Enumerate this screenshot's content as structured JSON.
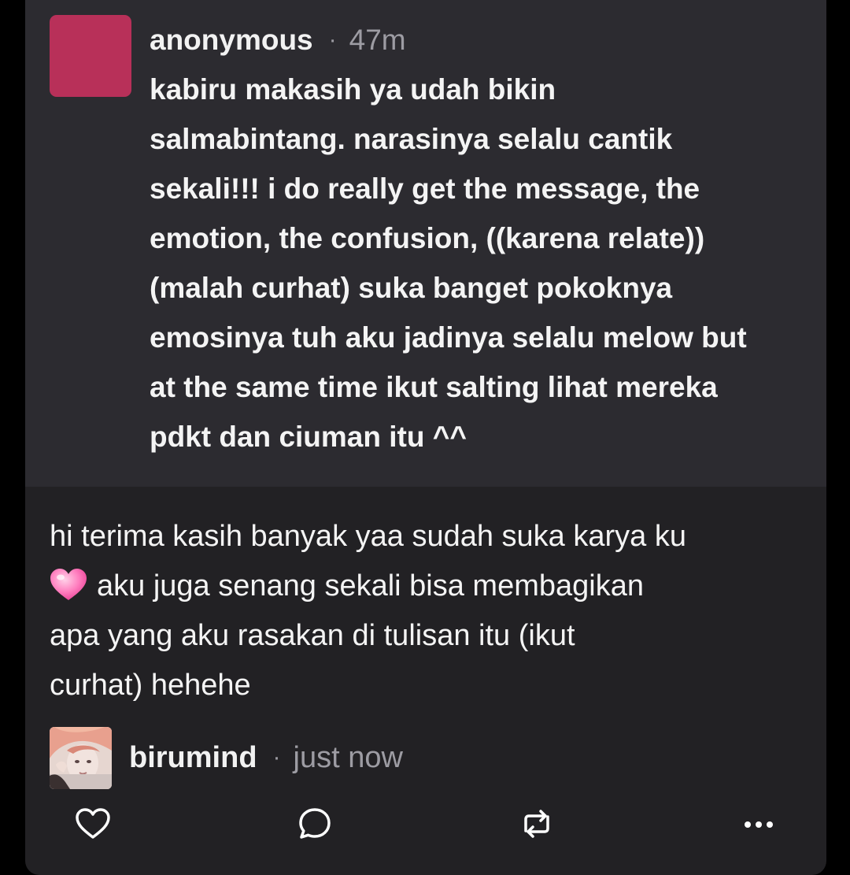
{
  "question": {
    "author": "anonymous",
    "separator": "·",
    "time": "47m",
    "lines": [
      "kabiru makasih ya udah bikin",
      "salmabintang. narasinya selalu cantik",
      "sekali!!! i do really get the message, the",
      "emotion, the confusion, ((karena relate))",
      "(malah curhat) suka banget pokoknya",
      "emosinya tuh aku jadinya selalu melow but",
      "at the same time ikut salting lihat mereka",
      "pdkt dan ciuman itu ^^"
    ]
  },
  "answer": {
    "line1": "hi terima kasih banyak yaa sudah suka karya ku",
    "line2": "aku juga senang sekali bisa membagikan",
    "line3": "apa yang aku rasakan di tulisan itu (ikut",
    "line4": "curhat) hehehe",
    "emoji": "pink-heart-icon"
  },
  "author": {
    "name": "birumind",
    "separator": "·",
    "time": "just now"
  },
  "actions": {
    "like": "heart-outline-icon",
    "reply": "speech-bubble-icon",
    "repost": "repost-icon",
    "more": "more-dots-icon"
  },
  "colors": {
    "background": "#000000",
    "card": "#222124",
    "question_bg": "#2c2b30",
    "anon_avatar": "#b83059",
    "muted_text": "#9d9ca3",
    "text": "#f4f4f4"
  }
}
